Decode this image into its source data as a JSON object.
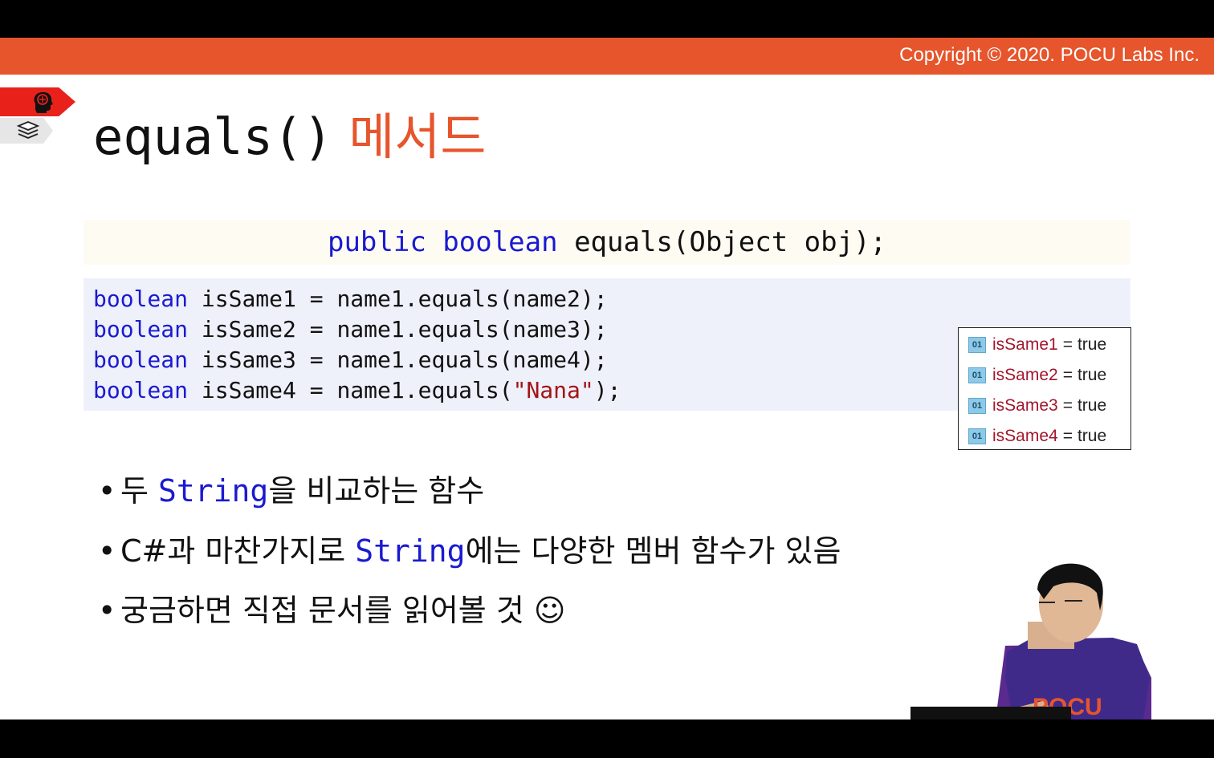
{
  "copyright": "Copyright © 2020. POCU Labs Inc.",
  "title": {
    "code": "equals()",
    "korean": "메서드"
  },
  "signature": {
    "public": "public",
    "boolean": "boolean",
    "rest": "equals(Object obj);"
  },
  "code_lines": [
    {
      "keyword": "boolean",
      "pre": " isSame1 = name1.equals(name2);",
      "string": "",
      "post": ""
    },
    {
      "keyword": "boolean",
      "pre": " isSame2 = name1.equals(name3);",
      "string": "",
      "post": ""
    },
    {
      "keyword": "boolean",
      "pre": " isSame3 = name1.equals(name4);",
      "string": "",
      "post": ""
    },
    {
      "keyword": "boolean",
      "pre": " isSame4 = name1.equals(",
      "string": "\"Nana\"",
      "post": ");"
    }
  ],
  "debug": {
    "icon_label": "01",
    "rows": [
      {
        "name": "isSame1",
        "value": "true"
      },
      {
        "name": "isSame2",
        "value": "true"
      },
      {
        "name": "isSame3",
        "value": "true"
      },
      {
        "name": "isSame4",
        "value": "true"
      }
    ]
  },
  "bullets": [
    {
      "pre": "두 ",
      "code": "String",
      "post": "을 비교하는 함수"
    },
    {
      "pre": "C#과 마찬가지로 ",
      "code": "String",
      "post": "에는 다양한 멤버 함수가 있음"
    },
    {
      "pre": "궁금하면 직접 문서를 읽어볼 것 ☺",
      "code": "",
      "post": ""
    }
  ],
  "presenter_shirt_text": "POCU",
  "icons": [
    "brain-icon",
    "book-stack-icon",
    "variable-icon"
  ],
  "colors": {
    "accent": "#e6552c",
    "keyword": "#1a1ad0",
    "string": "#a31515"
  }
}
